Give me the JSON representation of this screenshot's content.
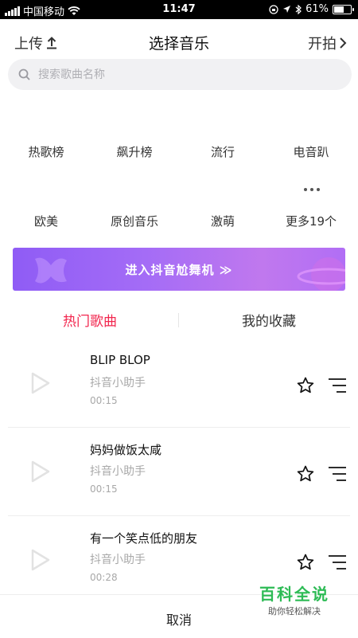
{
  "status_bar": {
    "carrier": "中国移动",
    "time": "11:47",
    "battery": "61%",
    "battery_level": 0.61
  },
  "header": {
    "upload_label": "上传",
    "title": "选择音乐",
    "start_label": "开拍"
  },
  "search": {
    "placeholder": "搜索歌曲名称"
  },
  "categories": [
    "热歌榜",
    "飙升榜",
    "流行",
    "电音趴",
    "欧美",
    "原创音乐",
    "激萌",
    "更多19个"
  ],
  "banner": {
    "label": "进入抖音尬舞机 ≫",
    "colors": [
      "#8f5cf5",
      "#c078ee"
    ]
  },
  "tabs": {
    "hot": "热门歌曲",
    "favorites": "我的收藏",
    "active_color": "#f2264e"
  },
  "songs": [
    {
      "title": "BLIP BLOP",
      "artist": "抖音小助手",
      "duration": "00:15"
    },
    {
      "title": "妈妈做饭太咸",
      "artist": "抖音小助手",
      "duration": "00:15"
    },
    {
      "title": "有一个笑点低的朋友",
      "artist": "抖音小助手",
      "duration": "00:28"
    }
  ],
  "footer": {
    "cancel_label": "取消"
  },
  "watermark": {
    "title": "百科全说",
    "subtitle": "助你轻松解决"
  }
}
